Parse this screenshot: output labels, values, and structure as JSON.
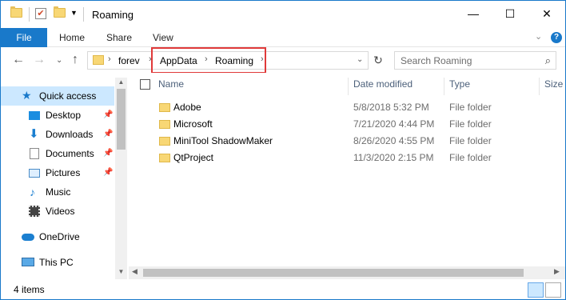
{
  "window": {
    "title": "Roaming",
    "controls": {
      "minimize": "—",
      "maximize": "☐",
      "close": "✕"
    }
  },
  "ribbon": {
    "tabs": [
      "File",
      "Home",
      "Share",
      "View"
    ],
    "expand": "⌄",
    "help": "?"
  },
  "navigation": {
    "back": "←",
    "forward": "→",
    "recent": "⌄",
    "up": "↑",
    "breadcrumb": [
      "forev",
      "AppData",
      "Roaming"
    ],
    "separator": "›",
    "dropdown": "⌄",
    "refresh": "↻"
  },
  "search": {
    "placeholder": "Search Roaming",
    "icon": "⌕"
  },
  "sidebar": {
    "items": [
      {
        "label": "Quick access",
        "icon": "star-icon",
        "selected": true,
        "pinned": false
      },
      {
        "label": "Desktop",
        "icon": "desktop-icon",
        "pinned": true
      },
      {
        "label": "Downloads",
        "icon": "download-icon",
        "pinned": true
      },
      {
        "label": "Documents",
        "icon": "documents-icon",
        "pinned": true
      },
      {
        "label": "Pictures",
        "icon": "pictures-icon",
        "pinned": true
      },
      {
        "label": "Music",
        "icon": "music-icon",
        "pinned": false
      },
      {
        "label": "Videos",
        "icon": "videos-icon",
        "pinned": false
      },
      {
        "label": "OneDrive",
        "icon": "cloud-icon",
        "pinned": false
      },
      {
        "label": "This PC",
        "icon": "computer-icon",
        "pinned": false
      }
    ],
    "pin_glyph": "📌"
  },
  "columns": [
    "Name",
    "Date modified",
    "Type",
    "Size"
  ],
  "files": [
    {
      "name": "Adobe",
      "date": "5/8/2018 5:32 PM",
      "type": "File folder"
    },
    {
      "name": "Microsoft",
      "date": "7/21/2020 4:44 PM",
      "type": "File folder"
    },
    {
      "name": "MiniTool ShadowMaker",
      "date": "8/26/2020 4:55 PM",
      "type": "File folder"
    },
    {
      "name": "QtProject",
      "date": "11/3/2020 2:15 PM",
      "type": "File folder"
    }
  ],
  "status": {
    "item_count": "4 items"
  },
  "colors": {
    "accent": "#1979ca",
    "selection": "#cce8ff",
    "highlight_box": "#e03a3a",
    "folder": "#f8d775"
  }
}
